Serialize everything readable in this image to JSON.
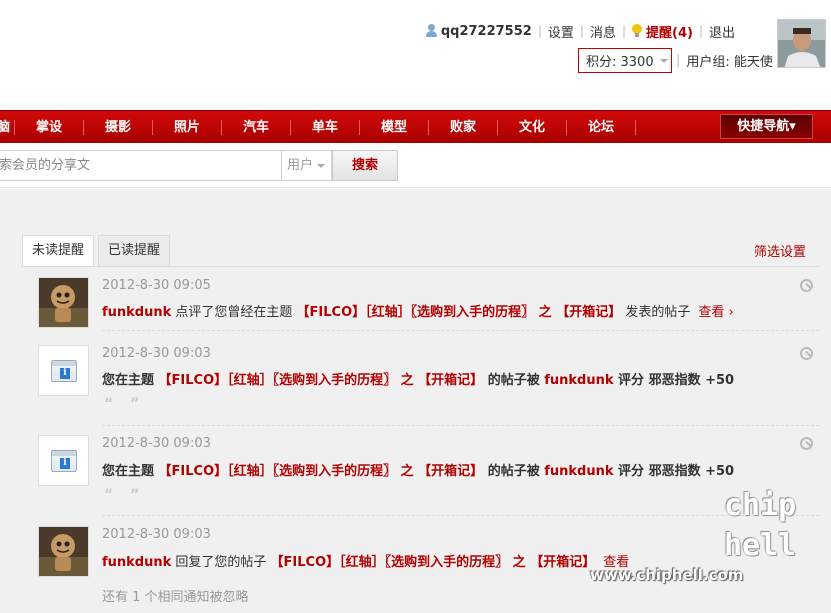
{
  "header": {
    "username": "qq27227552",
    "links": {
      "settings": "设置",
      "messages": "消息",
      "reminders": "提醒(4)",
      "logout": "退出"
    },
    "points": "积分: 3300",
    "usergroup": "用户组: 能天使"
  },
  "nav": {
    "items": [
      "电脑",
      "掌设",
      "摄影",
      "照片",
      "汽车",
      "单车",
      "模型",
      "败家",
      "文化",
      "论坛"
    ],
    "quick_nav": "快捷导航▾"
  },
  "search": {
    "placeholder": "索会员的分享文",
    "type": "用户",
    "button": "搜索"
  },
  "tabs": {
    "unread": "未读提醒",
    "read": "已读提醒",
    "filter": "筛选设置"
  },
  "notices": [
    {
      "time": "2012-8-30 09:05",
      "actor": "funkdunk",
      "text1": " 点评了您曾经在主题 ",
      "thread": "【FILCO】［红轴］〖选购到入手的历程〗 之 【开箱记】",
      "text2": " 发表的帖子",
      "more": "查看 ›"
    },
    {
      "time": "2012-8-30 09:03",
      "prefix": "您在主题 ",
      "thread": "【FILCO】［红轴］〖选购到入手的历程〗 之 【开箱记】",
      "mid": " 的帖子被 ",
      "actor": "funkdunk",
      "suffix": " 评分 邪恶指数 +50",
      "quote": "“ ”"
    },
    {
      "time": "2012-8-30 09:03",
      "prefix": "您在主题 ",
      "thread": "【FILCO】［红轴］〖选购到入手的历程〗 之 【开箱记】",
      "mid": " 的帖子被 ",
      "actor": "funkdunk",
      "suffix": " 评分 邪恶指数 +50",
      "quote": "“ ”"
    },
    {
      "time": "2012-8-30 09:03",
      "actor": "funkdunk",
      "text1": " 回复了您的帖子 ",
      "thread": "【FILCO】［红轴］〖选购到入手的历程〗 之 【开箱记】",
      "more": "查看"
    }
  ],
  "ignored_note": "还有 1 个相同通知被忽略",
  "watermark": {
    "logo": "chip hell",
    "url": "www.chiphell.com"
  },
  "colors": {
    "brand_red": "#b30000",
    "nav_red": "#c40000"
  }
}
